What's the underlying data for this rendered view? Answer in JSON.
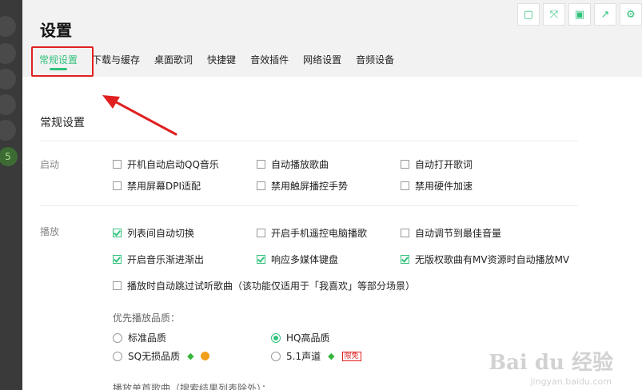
{
  "header": {
    "title": "设置",
    "toolbar": [
      {
        "name": "mini-mode-icon",
        "glyph": "▢"
      },
      {
        "name": "expand-icon",
        "glyph": "⤧"
      },
      {
        "name": "save-icon",
        "glyph": "▣"
      },
      {
        "name": "share-icon",
        "glyph": "↗"
      },
      {
        "name": "gear-icon",
        "glyph": "⚙"
      }
    ]
  },
  "tabs": [
    {
      "label": "常规设置",
      "active": true
    },
    {
      "label": "下载与缓存",
      "active": false
    },
    {
      "label": "桌面歌词",
      "active": false
    },
    {
      "label": "快捷键",
      "active": false
    },
    {
      "label": "音效插件",
      "active": false
    },
    {
      "label": "网络设置",
      "active": false
    },
    {
      "label": "音频设备",
      "active": false
    }
  ],
  "sidebar": {
    "badge": "5"
  },
  "main": {
    "section_title": "常规设置",
    "startup": {
      "label": "启动",
      "options": [
        {
          "label": "开机自动启动QQ音乐",
          "checked": false
        },
        {
          "label": "自动播放歌曲",
          "checked": false
        },
        {
          "label": "自动打开歌词",
          "checked": false
        },
        {
          "label": "禁用屏幕DPI适配",
          "checked": false
        },
        {
          "label": "禁用触屏播控手势",
          "checked": false
        },
        {
          "label": "禁用硬件加速",
          "checked": false
        }
      ]
    },
    "playback": {
      "label": "播放",
      "options": [
        {
          "label": "列表间自动切换",
          "checked": true
        },
        {
          "label": "开启手机遥控电脑播歌",
          "checked": false
        },
        {
          "label": "自动调节到最佳音量",
          "checked": false
        },
        {
          "label": "开启音乐渐进渐出",
          "checked": true
        },
        {
          "label": "响应多媒体键盘",
          "checked": true
        },
        {
          "label": "无版权歌曲有MV资源时自动播放MV",
          "checked": true
        },
        {
          "label": "播放时自动跳过试听歌曲（该功能仅适用于「我喜欢」等部分场景）",
          "checked": false
        }
      ],
      "quality_label": "优先播放品质：",
      "quality_options": [
        {
          "label": "标准品质",
          "selected": false
        },
        {
          "label": "HQ高品质",
          "selected": true
        },
        {
          "label": "SQ无损品质",
          "selected": false
        },
        {
          "label": "5.1声道",
          "selected": false
        }
      ],
      "limited_badge": "限免",
      "single_song_label": "播放单首歌曲（搜索结果列表除外）："
    }
  },
  "watermark": {
    "text": "Bai du 经验",
    "url": "jingyan.baidu.com"
  },
  "colors": {
    "accent": "#31c27c",
    "annotation": "#e02020"
  }
}
